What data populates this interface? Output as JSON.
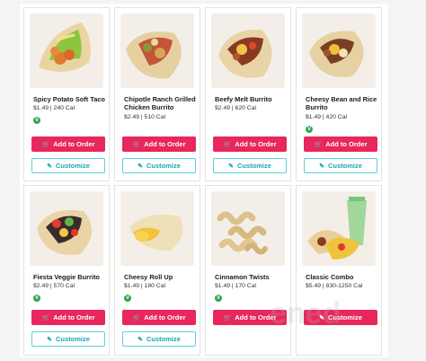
{
  "buttons": {
    "add_label": "Add to Order",
    "customize_label": "Customize"
  },
  "icons": {
    "cart": "cart-icon",
    "customize": "magic-wand-icon",
    "veggie": "vegetarian-badge-icon"
  },
  "colors": {
    "add_button": "#e8275c",
    "customize_border": "#5fd0d9",
    "customize_text": "#1aa5b3",
    "veggie_badge": "#2fa84f"
  },
  "watermark": "ened",
  "items": [
    {
      "name": "Spicy Potato Soft Taco",
      "price_cal": "$1.49 | 240 Cal",
      "vegetarian": true
    },
    {
      "name": "Chipotle Ranch Grilled Chicken Burrito",
      "price_cal": "$2.49 | 510 Cal",
      "vegetarian": false
    },
    {
      "name": "Beefy Melt Burrito",
      "price_cal": "$2.49 | 620 Cal",
      "vegetarian": false
    },
    {
      "name": "Cheesy Bean and Rice Burrito",
      "price_cal": "$1.49 | 420 Cal",
      "vegetarian": true
    },
    {
      "name": "Fiesta Veggie Burrito",
      "price_cal": "$2.49 | 570 Cal",
      "vegetarian": true
    },
    {
      "name": "Cheesy Roll Up",
      "price_cal": "$1.49 | 180 Cal",
      "vegetarian": true
    },
    {
      "name": "Cinnamon Twists",
      "price_cal": "$1.49 | 170 Cal",
      "vegetarian": true
    },
    {
      "name": "Classic Combo",
      "price_cal": "$5.49 | 830-1250 Cal",
      "vegetarian": false
    }
  ]
}
